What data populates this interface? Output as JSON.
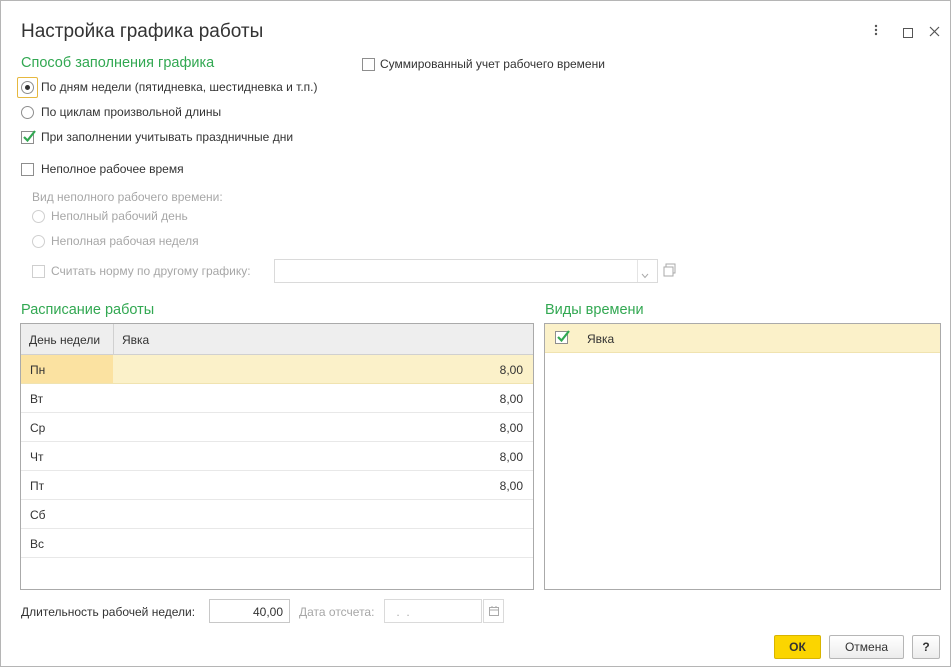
{
  "window": {
    "title": "Настройка графика работы",
    "more_icon": "more-vertical-icon",
    "maximize_icon": "maximize-icon",
    "close_icon": "close-icon"
  },
  "fill_method": {
    "title": "Способ заполнения графика",
    "option_weekdays": "По дням недели (пятидневка, шестидневка и т.п.)",
    "option_cycles": "По циклам произвольной длины",
    "selected": "weekdays",
    "holidays_label": "При заполнении учитывать праздничные дни",
    "holidays_checked": true
  },
  "summarized": {
    "label": "Суммированный учет рабочего времени",
    "checked": false
  },
  "part_time": {
    "label": "Неполное рабочее время",
    "checked": false,
    "kind_label": "Вид неполного рабочего времени:",
    "option_day": "Неполный рабочий день",
    "option_week": "Неполная рабочая неделя",
    "norm_label": "Считать норму по другому графику:",
    "norm_value": ""
  },
  "schedule": {
    "title": "Расписание работы",
    "columns": {
      "day": "День недели",
      "attendance": "Явка"
    },
    "rows": [
      {
        "day": "Пн",
        "value": "8,00"
      },
      {
        "day": "Вт",
        "value": "8,00"
      },
      {
        "day": "Ср",
        "value": "8,00"
      },
      {
        "day": "Чт",
        "value": "8,00"
      },
      {
        "day": "Пт",
        "value": "8,00"
      },
      {
        "day": "Сб",
        "value": ""
      },
      {
        "day": "Вс",
        "value": ""
      }
    ],
    "selected_row": 0
  },
  "time_types": {
    "title": "Виды времени",
    "items": [
      {
        "label": "Явка",
        "checked": true
      }
    ]
  },
  "footer": {
    "week_length_label": "Длительность рабочей недели:",
    "week_length_value": "40,00",
    "ref_date_label": "Дата отсчета:",
    "ref_date_value": " .  .",
    "ok_label": "ОК",
    "cancel_label": "Отмена",
    "help_label": "?"
  },
  "colors": {
    "section_title": "#32a852",
    "ok_button": "#fbd500",
    "selected_row": "#fbf1c9",
    "checkmark": "#32a852"
  }
}
